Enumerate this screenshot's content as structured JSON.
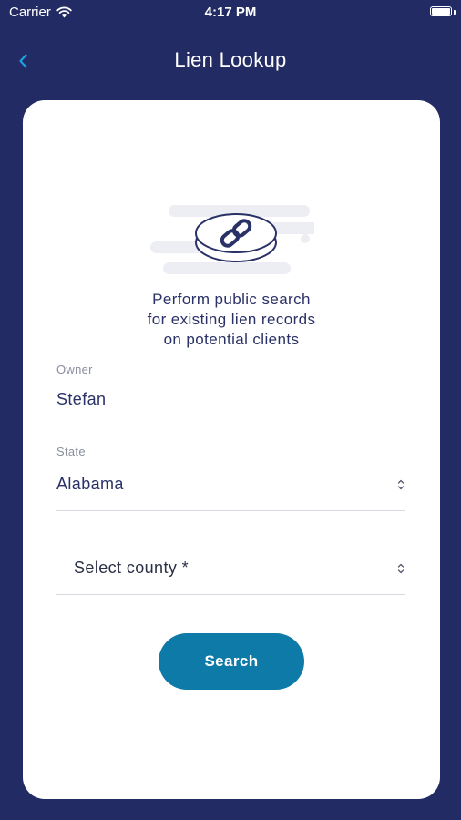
{
  "status_bar": {
    "carrier": "Carrier",
    "time": "4:17 PM",
    "wifi_icon": "wifi-icon",
    "battery_icon": "battery-icon"
  },
  "nav": {
    "title": "Lien Lookup",
    "back_icon": "chevron-left-icon"
  },
  "intro": {
    "line1": "Perform public search",
    "line2": "for existing lien records",
    "line3": "on potential clients",
    "illustration_icon": "chain-link-coin-icon"
  },
  "form": {
    "owner": {
      "label": "Owner",
      "value": "Stefan"
    },
    "state": {
      "label": "State",
      "value": "Alabama"
    },
    "county": {
      "placeholder": "Select county *"
    }
  },
  "search_label": "Search",
  "colors": {
    "background": "#222b63",
    "card": "#ffffff",
    "accent": "#0e7aa8",
    "back_icon": "#1ea1e0",
    "text_dark": "#2a3166",
    "label": "#8a8e9e",
    "divider": "#d7d9e0"
  }
}
